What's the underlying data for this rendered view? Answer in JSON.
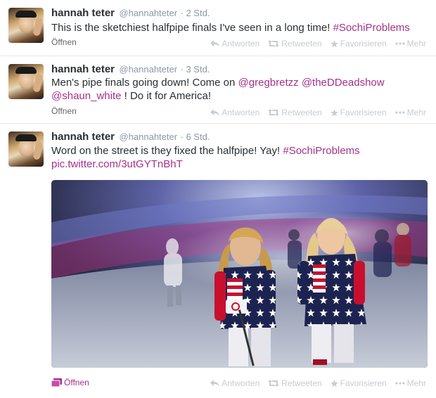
{
  "tweets": [
    {
      "name": "hannah teter",
      "handle": "@hannahteter",
      "time": "· 2 Std.",
      "text_parts": [
        "This is the sketchiest halfpipe finals I've seen in a long time! ",
        "#SochiProblems"
      ],
      "open_label": "Öffnen"
    },
    {
      "name": "hannah teter",
      "handle": "@hannahteter",
      "time": "· 3 Std.",
      "text_parts": [
        "Men's pipe finals going down! Come on ",
        "@gregbretzz",
        " ",
        "@theDDeadshow",
        "@shaun_white",
        " ! Do it for America!"
      ],
      "open_label": "Öffnen"
    },
    {
      "name": "hannah teter",
      "handle": "@hannahteter",
      "time": "· 6 Std.",
      "text_parts": [
        "Word on the street is they fixed the halfpipe! Yay! ",
        "#SochiProblems",
        "pic.twitter.com/3utGYTnBhT"
      ],
      "open_label": "Öffnen"
    }
  ],
  "actions": {
    "reply": "Antworten",
    "retweet": "Retweeten",
    "favorite": "Favorisieren",
    "more": "Mehr"
  },
  "colors": {
    "link": "#a4308b",
    "muted": "#8899a6",
    "action": "#c6ccd1"
  },
  "icons": [
    "reply-icon",
    "retweet-icon",
    "star-icon",
    "more-dots-icon",
    "photo-icon"
  ]
}
